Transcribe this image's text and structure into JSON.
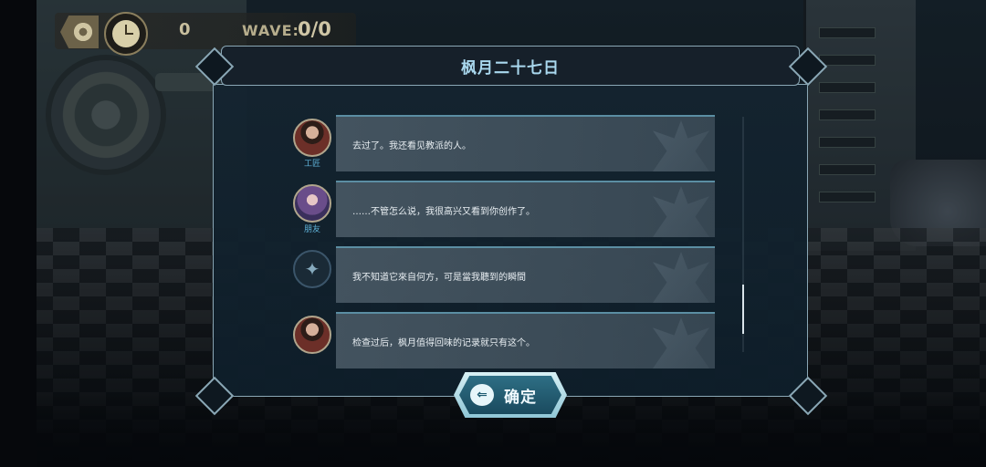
{
  "hud": {
    "count": "0",
    "wave_label": "WAVE:",
    "wave_value": "0/0"
  },
  "dialog": {
    "title": "枫月二十七日",
    "messages": [
      {
        "speaker": "工匠",
        "text": "去过了。我还看见教派的人。",
        "avatar": "craftsman-portrait"
      },
      {
        "speaker": "朋友",
        "text": "……不管怎么说，我很高兴又看到你创作了。",
        "avatar": "friend-portrait"
      },
      {
        "speaker": "",
        "text": "我不知道它來自何方，可是當我聽到的瞬間",
        "avatar": "emblem"
      },
      {
        "speaker": "",
        "text": "检查过后，枫月值得回味的记录就只有这个。",
        "avatar": "craftsman-portrait"
      }
    ],
    "scroll_position": 0.75,
    "confirm_label": "确定",
    "confirm_icon": "arrow-left-icon"
  },
  "colors": {
    "accent": "#a9d8ee",
    "speaker_name": "#5fb3d9",
    "frame": "#8aa7b5"
  }
}
